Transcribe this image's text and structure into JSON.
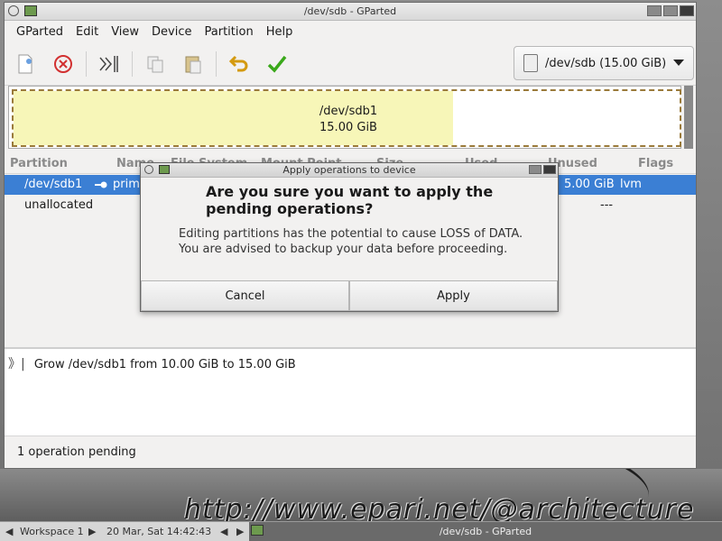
{
  "window": {
    "title": "/dev/sdb - GParted",
    "dialog_title": "Apply operations to device"
  },
  "menubar": [
    "GParted",
    "Edit",
    "View",
    "Device",
    "Partition",
    "Help"
  ],
  "toolbar": {
    "icons": [
      "new-partition-icon",
      "delete-icon",
      "resize-move-icon",
      "copy-icon",
      "paste-icon",
      "undo-icon",
      "apply-icon"
    ],
    "device": "/dev/sdb  (15.00 GiB)"
  },
  "diskmap": {
    "partition": "/dev/sdb1",
    "size": "15.00 GiB",
    "used_fraction": 0.66
  },
  "table": {
    "headers": [
      "Partition",
      "Name",
      "File System",
      "Mount Point",
      "Size",
      "Used",
      "Unused",
      "Flags"
    ],
    "rows": [
      {
        "partition": "/dev/sdb1",
        "name": "prim",
        "unused": "5.00 GiB",
        "flags": "lvm"
      },
      {
        "partition": "unallocated",
        "name": "",
        "unused": "",
        "flags": "---"
      }
    ]
  },
  "operations": {
    "items": [
      "Grow /dev/sdb1 from 10.00 GiB to 15.00 GiB"
    ],
    "status": "1 operation pending"
  },
  "dialog": {
    "heading_line1": "Are you sure you want to apply the",
    "heading_line2": "pending operations?",
    "body_line1": "Editing partitions has the potential to cause LOSS of DATA.",
    "body_line2": "You are advised to backup your data before proceeding.",
    "cancel": "Cancel",
    "apply": "Apply"
  },
  "watermark": "http://www.epari.net/@architecture",
  "taskbar": {
    "workspace": "Workspace 1",
    "clock": "20 Mar, Sat 14:42:43",
    "task": "/dev/sdb - GParted"
  }
}
